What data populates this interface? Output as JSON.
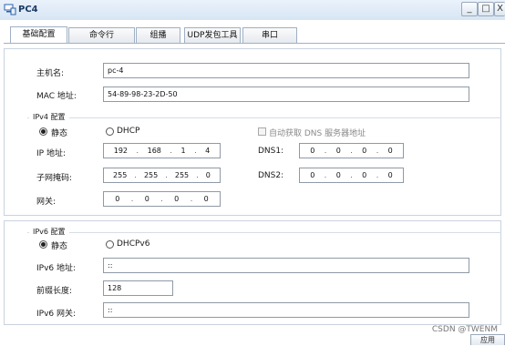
{
  "window": {
    "title": "PC4",
    "minimize_glyph": "_",
    "maximize_glyph": "□",
    "close_glyph": "X"
  },
  "tabs": [
    {
      "label": "基础配置",
      "active": true
    },
    {
      "label": "命令行",
      "active": false
    },
    {
      "label": "组播",
      "active": false
    },
    {
      "label": "UDP发包工具",
      "active": false
    },
    {
      "label": "串口",
      "active": false
    }
  ],
  "basic": {
    "hostname_label": "主机名:",
    "hostname_value": "pc-4",
    "mac_label": "MAC 地址:",
    "mac_value": "54-89-98-23-2D-50"
  },
  "ipv4": {
    "section_title": "IPv4 配置",
    "static_label": "静态",
    "dhcp_label": "DHCP",
    "mode": "static",
    "auto_dns_label": "自动获取 DNS 服务器地址",
    "ip_label": "IP 地址:",
    "ip": [
      "192",
      "168",
      "1",
      "4"
    ],
    "mask_label": "子网掩码:",
    "mask": [
      "255",
      "255",
      "255",
      "0"
    ],
    "gateway_label": "网关:",
    "gateway": [
      "0",
      "0",
      "0",
      "0"
    ],
    "dns1_label": "DNS1:",
    "dns1": [
      "0",
      "0",
      "0",
      "0"
    ],
    "dns2_label": "DNS2:",
    "dns2": [
      "0",
      "0",
      "0",
      "0"
    ]
  },
  "ipv6": {
    "section_title": "IPv6 配置",
    "static_label": "静态",
    "dhcp_label": "DHCPv6",
    "mode": "static",
    "address_label": "IPv6 地址:",
    "address_value": "::",
    "prefix_label": "前缀长度:",
    "prefix_value": "128",
    "gateway_label": "IPv6 网关:",
    "gateway_value": "::"
  },
  "footer": {
    "watermark": "CSDN @TWENM",
    "apply_label": "应用"
  },
  "colors": {
    "titlebar": "#d7e5f4",
    "title_text": "#1b3a66",
    "border": "#9fb0c4"
  }
}
